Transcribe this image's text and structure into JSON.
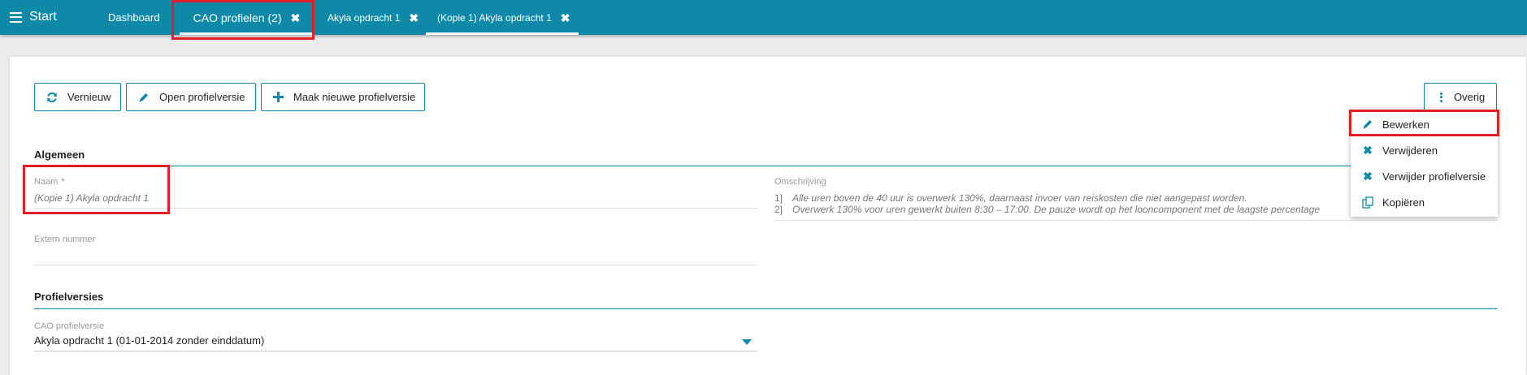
{
  "topbar": {
    "start_label": "Start",
    "tabs": [
      {
        "label": "Dashboard"
      },
      {
        "label": "CAO profielen (2)",
        "close": "✖"
      },
      {
        "label": "Akyla opdracht 1",
        "close": "✖"
      },
      {
        "label": "(Kopie 1) Akyla opdracht 1",
        "close": "✖"
      }
    ]
  },
  "toolbar": {
    "vernieuw_label": "Vernieuw",
    "open_label": "Open profielversie",
    "maak_label": "Maak nieuwe profielversie",
    "overig_label": "Overig"
  },
  "dropdown": {
    "items": [
      {
        "label": "Bewerken",
        "icon": "pencil-icon"
      },
      {
        "label": "Verwijderen",
        "icon": "x-icon"
      },
      {
        "label": "Verwijder profielversie",
        "icon": "x-icon"
      },
      {
        "label": "Kopiëren",
        "icon": "copy-icon"
      }
    ]
  },
  "algemeen": {
    "title": "Algemeen",
    "naam_label": "Naam",
    "naam_required": "*",
    "naam_value": "(Kopie 1) Akyla opdracht 1",
    "extern_label": "Extern nummer",
    "extern_value": "",
    "omschrijving_label": "Omschrijving",
    "omschrijving_lines": [
      {
        "num": "1]",
        "text": "Alle uren boven de 40 uur is overwerk 130%, daarnaast invoer van reiskosten die niet aangepast worden."
      },
      {
        "num": "2]",
        "text": "Overwerk 130% voor uren gewerkt buiten 8:30 – 17:00. De pauze wordt op het looncomponent met de laagste percentage"
      }
    ]
  },
  "profielversies": {
    "title": "Profielversies",
    "select_label": "CAO profielversie",
    "select_value": "Akyla opdracht 1 (01-01-2014 zonder einddatum)"
  },
  "colors": {
    "brand": "#0e8aa8",
    "highlight": "#e01f26"
  }
}
